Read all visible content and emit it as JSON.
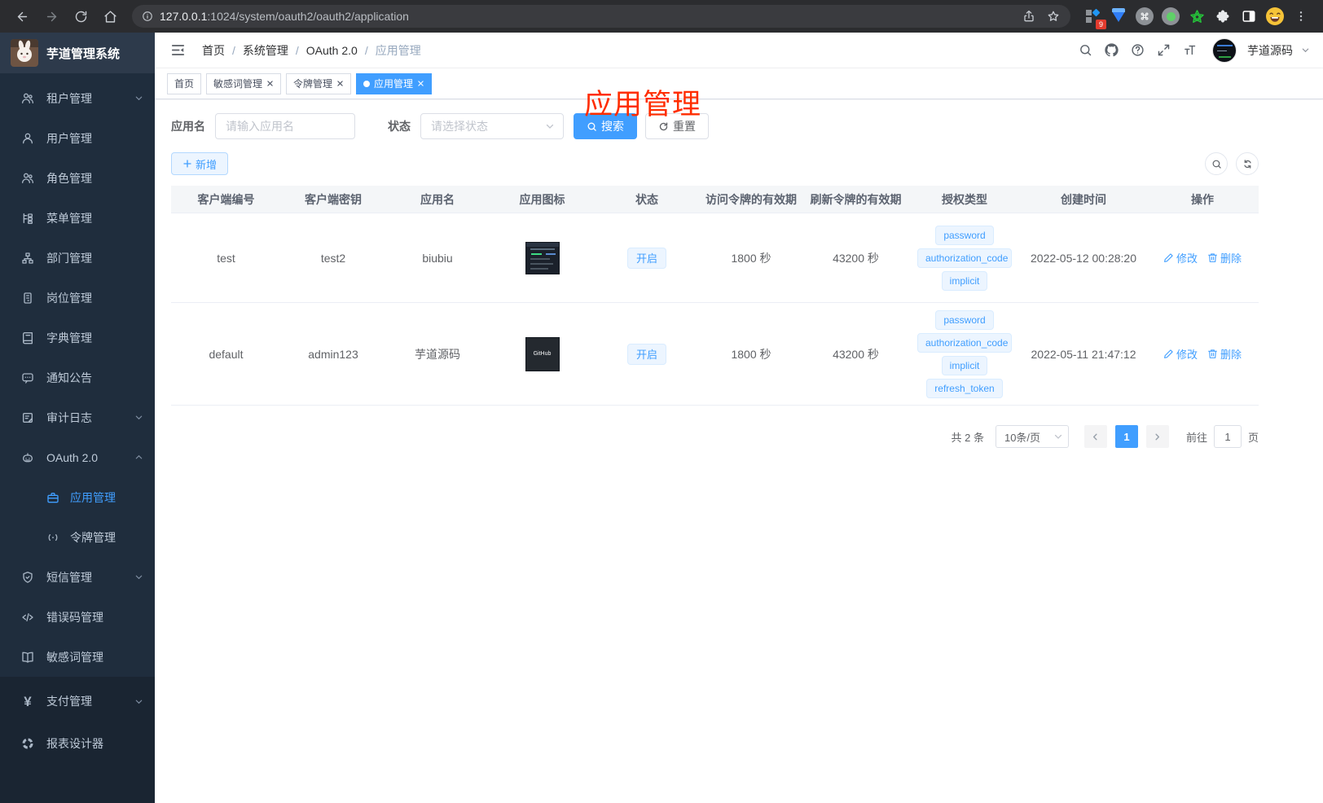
{
  "browser": {
    "url_host": "127.0.0.1",
    "url_rest": ":1024/system/oauth2/oauth2/application",
    "extension_badge": "9"
  },
  "sidebar": {
    "title": "芋道管理系统",
    "items": [
      {
        "label": "租户管理"
      },
      {
        "label": "用户管理"
      },
      {
        "label": "角色管理"
      },
      {
        "label": "菜单管理"
      },
      {
        "label": "部门管理"
      },
      {
        "label": "岗位管理"
      },
      {
        "label": "字典管理"
      },
      {
        "label": "通知公告"
      },
      {
        "label": "审计日志"
      },
      {
        "label": "OAuth 2.0"
      },
      {
        "label": "短信管理"
      },
      {
        "label": "错误码管理"
      },
      {
        "label": "敏感词管理"
      },
      {
        "label": "支付管理"
      },
      {
        "label": "报表设计器"
      }
    ],
    "oauth_children": [
      {
        "label": "应用管理"
      },
      {
        "label": "令牌管理"
      }
    ]
  },
  "header": {
    "breadcrumbs": [
      "首页",
      "系统管理",
      "OAuth 2.0",
      "应用管理"
    ],
    "separator": "/",
    "user_name": "芋道源码"
  },
  "annotation": {
    "text": "应用管理",
    "color": "#ff2d00"
  },
  "tabs": [
    {
      "label": "首页"
    },
    {
      "label": "敏感词管理"
    },
    {
      "label": "令牌管理"
    },
    {
      "label": "应用管理"
    }
  ],
  "filter": {
    "name_label": "应用名",
    "name_placeholder": "请输入应用名",
    "status_label": "状态",
    "status_placeholder": "请选择状态",
    "search_button": "搜索",
    "reset_button": "重置"
  },
  "toolbar": {
    "add_button": "新增"
  },
  "table": {
    "headers": [
      "客户端编号",
      "客户端密钥",
      "应用名",
      "应用图标",
      "状态",
      "访问令牌的有效期",
      "刷新令牌的有效期",
      "授权类型",
      "创建时间",
      "操作"
    ],
    "rows": [
      {
        "client_id": "test",
        "client_secret": "test2",
        "app_name": "biubiu",
        "icon_text": "",
        "status": "开启",
        "access_token_ttl": "1800 秒",
        "refresh_token_ttl": "43200 秒",
        "grant_types": [
          "password",
          "authorization_code",
          "implicit"
        ],
        "create_time": "2022-05-12 00:28:20",
        "edit_label": "修改",
        "delete_label": "删除"
      },
      {
        "client_id": "default",
        "client_secret": "admin123",
        "app_name": "芋道源码",
        "icon_text": "GitHub",
        "status": "开启",
        "access_token_ttl": "1800 秒",
        "refresh_token_ttl": "43200 秒",
        "grant_types": [
          "password",
          "authorization_code",
          "implicit",
          "refresh_token"
        ],
        "create_time": "2022-05-11 21:47:12",
        "edit_label": "修改",
        "delete_label": "删除"
      }
    ]
  },
  "pagination": {
    "total_text": "共 2 条",
    "page_size_text": "10条/页",
    "current_page": "1",
    "goto_label": "前往",
    "goto_value": "1",
    "page_unit": "页"
  },
  "colors": {
    "accent": "#409eff",
    "sidebar_bg": "#1f2d3d",
    "tag_bg": "#ecf5ff"
  }
}
